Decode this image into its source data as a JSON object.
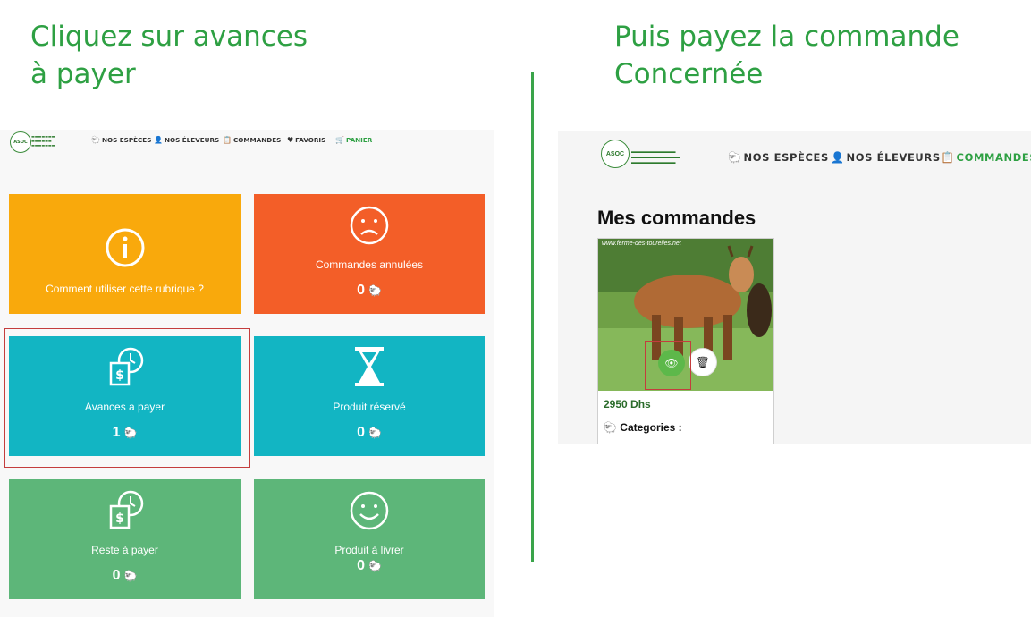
{
  "instructions": {
    "left_line1": "Cliquez sur avances",
    "left_line2": "à payer",
    "right_line1": "Puis payez la commande",
    "right_line2": "Concernée"
  },
  "colors": {
    "heading": "#2ea043",
    "orange": "#f9a90c",
    "red_orange": "#f35e28",
    "teal": "#12b5c3",
    "green": "#5db679",
    "highlight": "#c43d3d"
  },
  "left_app": {
    "logo": "ASOC",
    "nav": [
      {
        "icon": "sheep-icon",
        "label": "NOS ESPÈCES"
      },
      {
        "icon": "user-icon",
        "label": "NOS ÉLEVEURS"
      },
      {
        "icon": "clipboard-icon",
        "label": "COMMANDES"
      },
      {
        "icon": "heart-icon",
        "label": "FAVORIS"
      },
      {
        "icon": "cart-icon",
        "label": "PANIER"
      }
    ],
    "tiles": [
      {
        "label": "Comment utiliser cette rubrique ?",
        "icon": "info-icon",
        "count": ""
      },
      {
        "label": "Commandes annulées",
        "icon": "sad-face-icon",
        "count": "0"
      },
      {
        "label": "Avances a payer",
        "icon": "payment-icon",
        "count": "1"
      },
      {
        "label": "Produit réservé",
        "icon": "hourglass-icon",
        "count": "0"
      },
      {
        "label": "Reste à payer",
        "icon": "payment-icon",
        "count": "0"
      },
      {
        "label": "Produit à livrer",
        "icon": "smiley-icon",
        "count": "0"
      }
    ]
  },
  "right_app": {
    "logo": "ASOC",
    "nav": [
      {
        "icon": "sheep-icon",
        "label": "NOS ESPÈCES"
      },
      {
        "icon": "user-icon",
        "label": "NOS ÉLEVEURS"
      },
      {
        "icon": "clipboard-icon",
        "label": "COMMANDES"
      }
    ],
    "page_title": "Mes commandes",
    "order": {
      "watermark": "www.ferme-des-tourelles.net",
      "price": "2950 Dhs",
      "categories_label": "Categories :"
    }
  }
}
